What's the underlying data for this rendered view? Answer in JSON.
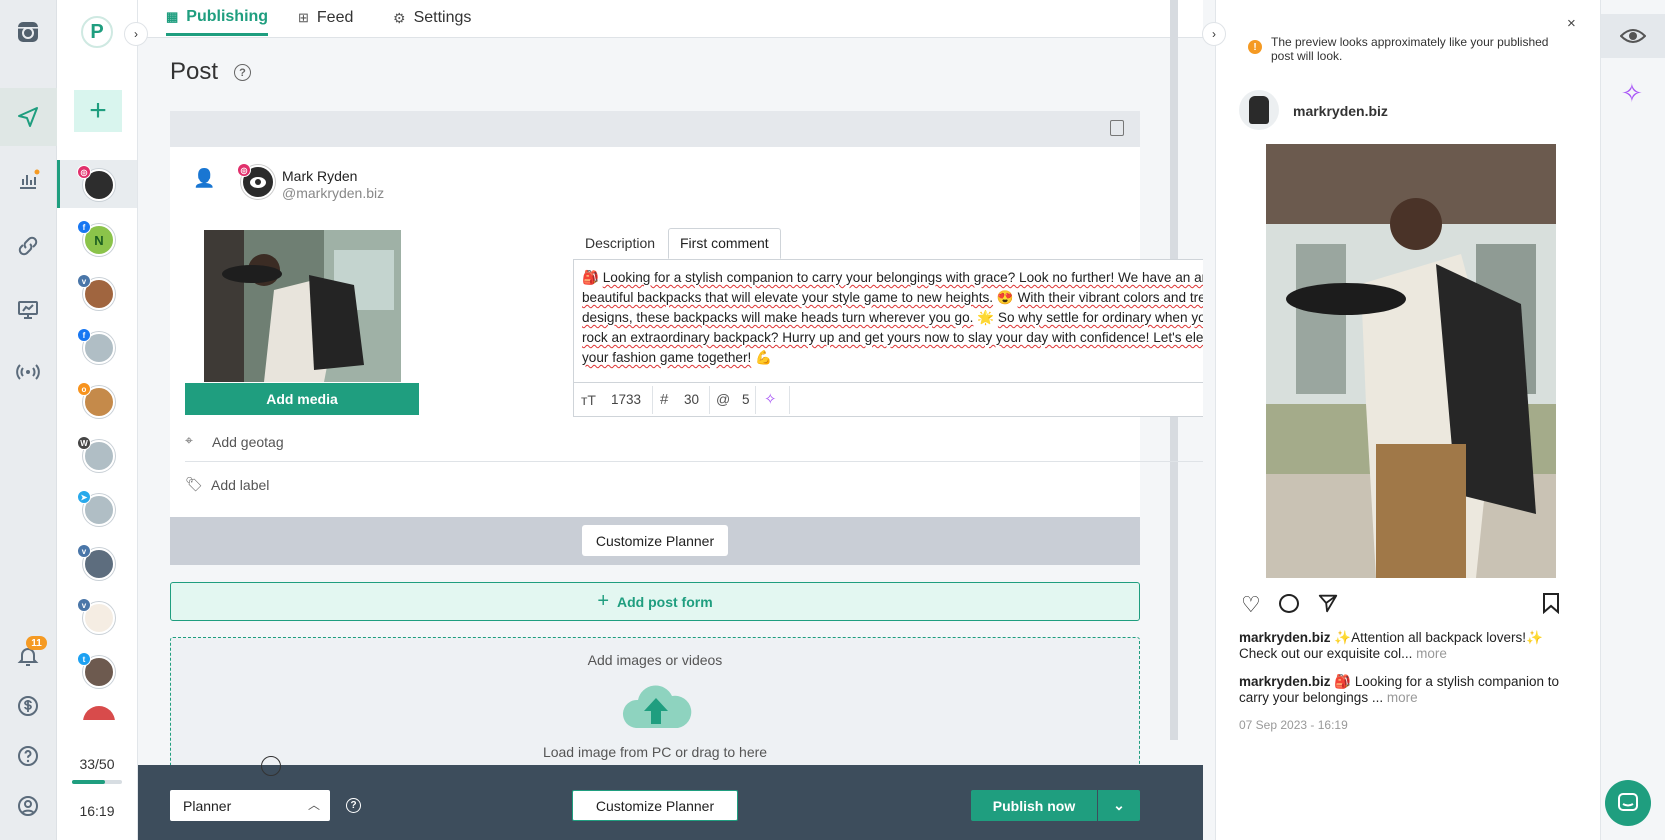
{
  "rail": {
    "icons": [
      "instagram-logo-icon",
      "send-icon",
      "analytics-icon",
      "link-icon",
      "monitor-icon",
      "broadcast-icon",
      "bell-icon",
      "dollar-icon",
      "help-icon",
      "account-icon"
    ],
    "notifications_count": "11"
  },
  "accounts": {
    "logo_letter": "P",
    "quota": "33/50",
    "quota_fraction": 0.66,
    "time": "16:19"
  },
  "tabs": [
    {
      "label": "Publishing"
    },
    {
      "label": "Feed"
    },
    {
      "label": "Settings"
    }
  ],
  "post": {
    "title": "Post",
    "profile_name": "Mark Ryden",
    "profile_handle": "@markryden.biz",
    "add_media": "Add media",
    "editor_tabs": [
      "Description",
      "First comment"
    ],
    "text_parts": [
      "Looking for a stylish companion to carry your belongings with grace? Look no further! We have an array of beautiful backpacks that will elevate your style game to new heights.",
      "With their vibrant colors and trendy designs, these backpacks will make heads turn wherever you go.",
      "So why settle for ordinary when you can rock an extraordinary backpack? Hurry up and get yours now to slay your day with confidence! Let's elevate your fashion game together!"
    ],
    "char_count": "1733",
    "hashtag_count": "30",
    "mention_count": "5",
    "geotag": "Add geotag",
    "label": "Add label",
    "customize_planner": "Customize Planner",
    "add_post_form": "Add post form",
    "dropzone_title": "Add images or videos",
    "dropzone_hint": "Load image from PC or drag to here"
  },
  "bottom": {
    "planner_select": "Planner",
    "customize_planner": "Customize Planner",
    "publish_now": "Publish now"
  },
  "preview": {
    "notice": "The preview looks approximately like your published post will look.",
    "username": "markryden.biz",
    "caption_user": "markryden.biz",
    "caption_text": "Attention all backpack lovers!",
    "caption_more_line": "Check out our exquisite col...",
    "more": "more",
    "comment_user": "markryden.biz",
    "comment_text": "Looking for a stylish companion to",
    "comment_more_line": "carry your belongings ...",
    "timestamp": "07 Sep 2023 - 16:19"
  },
  "colors": {
    "accent": "#1f9e7f",
    "dark_bar": "#3d4d5c",
    "notification": "#f59a23"
  }
}
